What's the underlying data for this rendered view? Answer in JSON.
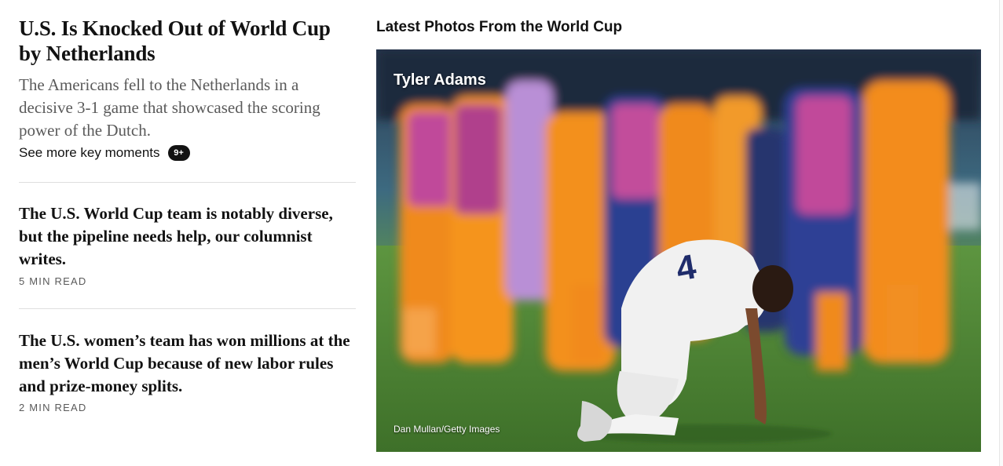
{
  "lead_story": {
    "headline": "U.S. Is Knocked Out of World Cup by Netherlands",
    "summary": "The Americans fell to the Netherlands in a decisive 3-1 game that showcased the scoring power of the Dutch.",
    "key_moments_link": "See more key moments",
    "key_moments_badge": "9+"
  },
  "stories": [
    {
      "headline": "The U.S. World Cup team is notably diverse, but the pipeline needs help, our columnist writes.",
      "read_time": "5 MIN READ"
    },
    {
      "headline": "The U.S. women’s team has won millions at the men’s World Cup because of new labor rules and prize-money splits.",
      "read_time": "2 MIN READ"
    }
  ],
  "photos": {
    "section_title": "Latest Photos From the World Cup",
    "caption_name": "Tyler Adams",
    "credit": "Dan Mullan/Getty Images",
    "jersey_number": "4"
  },
  "colors": {
    "text": "#121212",
    "secondary_text": "#5a5a5a",
    "divider": "#dfdfdf",
    "pitch_green": "#4f8a3a",
    "dutch_orange": "#f08a1c"
  }
}
